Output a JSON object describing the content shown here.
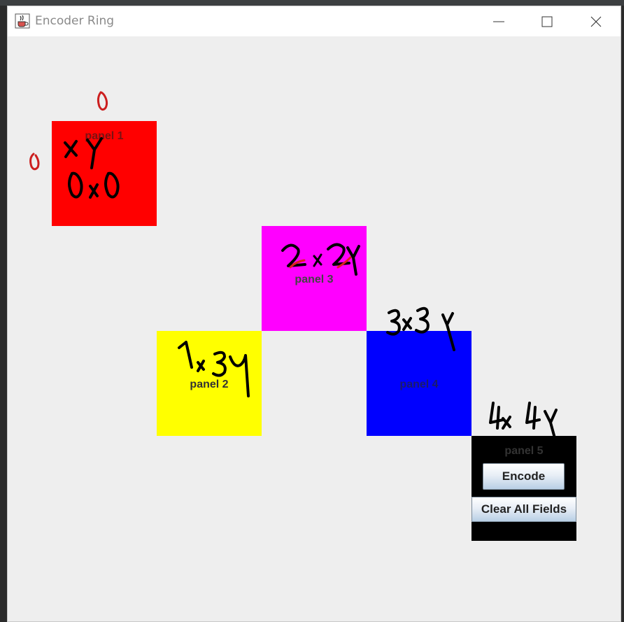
{
  "window": {
    "title": "Encoder Ring",
    "icon": "java-coffee-cup-icon",
    "controls": {
      "minimize_icon": "minimize-icon",
      "maximize_icon": "maximize-icon",
      "close_icon": "close-icon"
    }
  },
  "panels": [
    {
      "label": "panel 1",
      "color": "#ff0000"
    },
    {
      "label": "panel 2",
      "color": "#ffff00"
    },
    {
      "label": "panel 3",
      "color": "#ff00ff"
    },
    {
      "label": "panel 4",
      "color": "#0000ff"
    },
    {
      "label": "panel 5",
      "color": "#000000"
    }
  ],
  "buttons": {
    "encode": "Encode",
    "clear": "Clear All Fields"
  },
  "annotations": {
    "top_zero": "0",
    "left_zero": "0",
    "p1_axes": "x y",
    "p1_coords": "0 x 0",
    "p2_coords": "1 x 3y",
    "p3_coords": "2x 2y",
    "p4_coords": "3x 3y",
    "p5_coords": "4x 4y"
  }
}
